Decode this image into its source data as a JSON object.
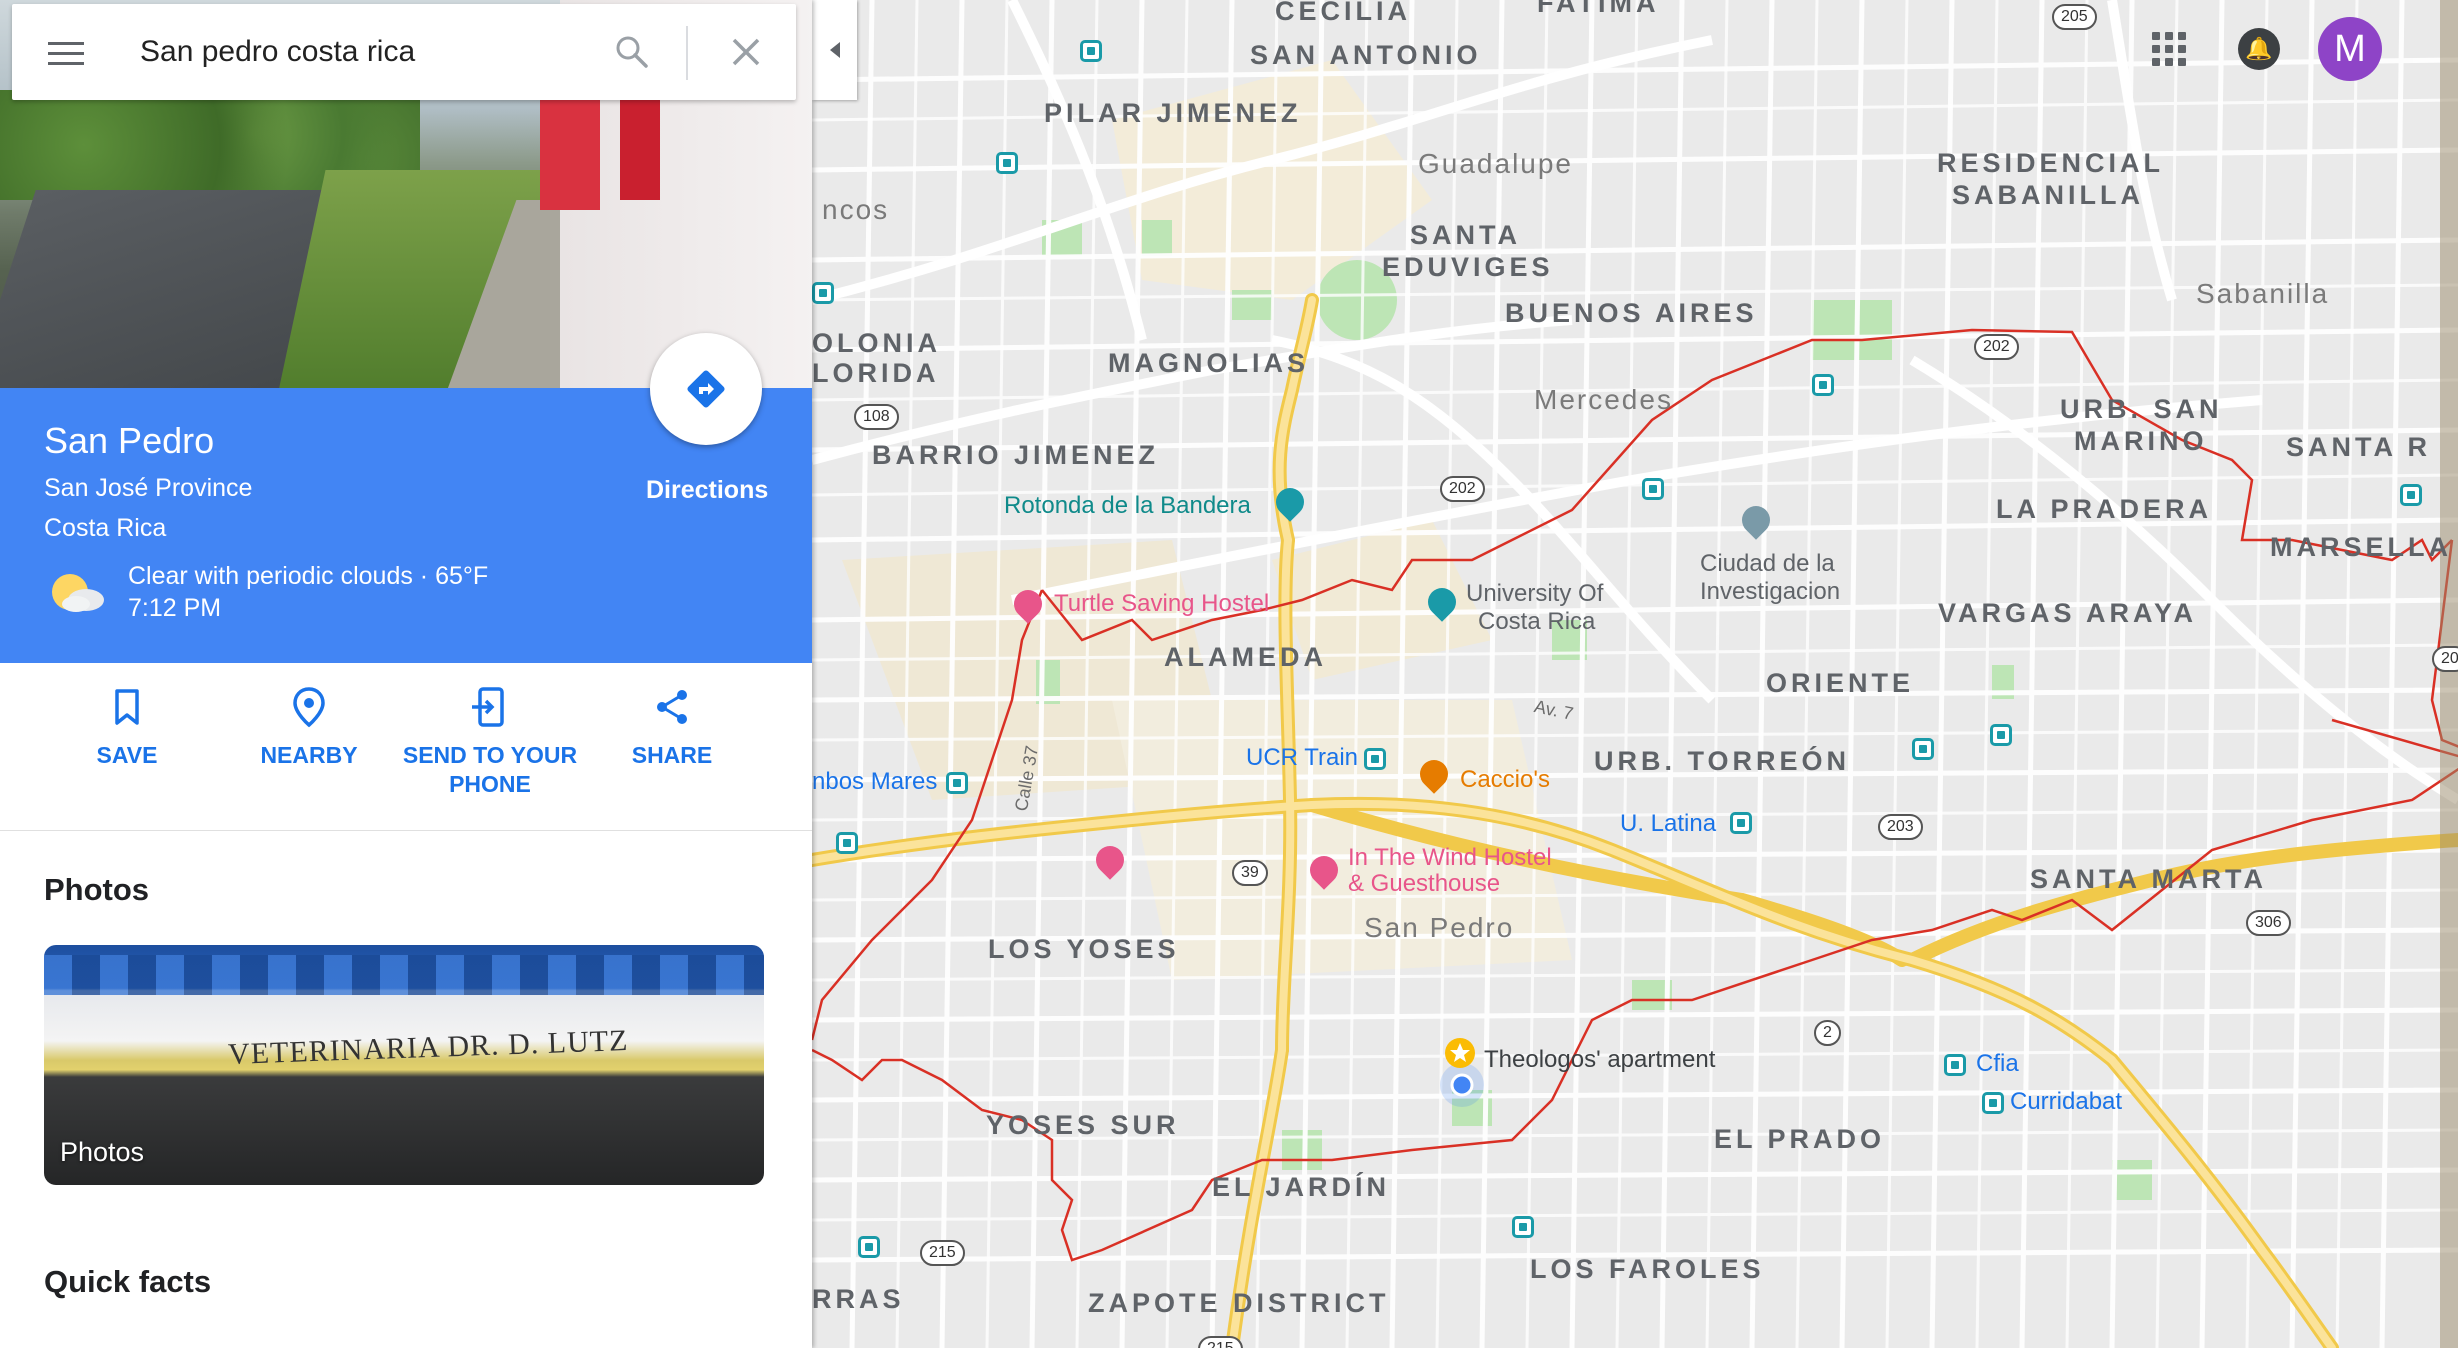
{
  "search": {
    "query": "San pedro costa rica"
  },
  "place": {
    "title": "San Pedro",
    "region": "San José Province",
    "country": "Costa Rica",
    "weather": "Clear with periodic clouds · 65°F",
    "time": "7:12 PM",
    "directions_label": "Directions"
  },
  "actions": {
    "save": "SAVE",
    "nearby": "NEARBY",
    "send_line1": "SEND TO YOUR",
    "send_line2": "PHONE",
    "share": "SHARE"
  },
  "photos": {
    "section_title": "Photos",
    "card_caption": "Photos",
    "sign_text": "VETERINARIA DR. D. LUTZ"
  },
  "quick_facts": {
    "section_title": "Quick facts"
  },
  "account": {
    "avatar_letter": "M"
  },
  "map": {
    "districts": {
      "cecilia": "CECILIA",
      "fatima": "FATIMA",
      "san_antonio": "SAN ANTONIO",
      "pilar_jimenez": "PILAR JIMENEZ",
      "residencial_sabanilla_1": "RESIDENCIAL",
      "residencial_sabanilla_2": "SABANILLA",
      "santa_eduviges_1": "SANTA",
      "santa_eduviges_2": "EDUVIGES",
      "buenos_aires": "BUENOS AIRES",
      "colonia_1": "OLONIA",
      "colonia_2": "LORIDA",
      "magnolias": "MAGNOLIAS",
      "barrio_jimenez": "BARRIO JIMENEZ",
      "urb_san_marino_1": "URB. SAN",
      "urb_san_marino_2": "MARINO",
      "santa_r": "SANTA R",
      "la_pradera": "LA PRADERA",
      "marsella": "MARSELLA",
      "vargas_araya": "VARGAS ARAYA",
      "alameda": "ALAMEDA",
      "oriente": "ORIENTE",
      "urb_torreon": "URB. TORREÓN",
      "santa_marta": "SANTA MARTA",
      "los_yoses": "LOS YOSES",
      "yoses_sur": "YOSES SUR",
      "el_prado": "EL PRADO",
      "el_jardin": "EL JARDÍN",
      "los_faroles": "LOS FAROLES",
      "zapote_district": "ZAPOTE DISTRICT",
      "rras": "RRAS"
    },
    "towns": {
      "guadalupe": "Guadalupe",
      "mercedes": "Mercedes",
      "sabanilla": "Sabanilla",
      "san_pedro": "San Pedro",
      "ncos": "ncos"
    },
    "pois": {
      "rotonda": "Rotonda de la Bandera",
      "turtle_hostel": "Turtle Saving Hostel",
      "ucr_1": "University Of",
      "ucr_2": "Costa Rica",
      "ciudad_1": "Ciudad de la",
      "ciudad_2": "Investigacion",
      "ucr_train": "UCR Train",
      "caccios": "Caccio's",
      "u_latina": "U. Latina",
      "wind_hostel_1": "In The Wind Hostel",
      "wind_hostel_2": "& Guesthouse",
      "theologos": "Theologos' apartment",
      "cfia": "Cfia",
      "curridabat": "Curridabat",
      "bos_mares": "nbos Mares"
    },
    "streets": {
      "av7": "Av. 7",
      "calle37": "Calle 37"
    },
    "route_shields": {
      "r205": "205",
      "r202a": "202",
      "r202b": "202",
      "r108": "108",
      "r39": "39",
      "r203": "203",
      "r306": "306",
      "r2": "2",
      "r215": "215",
      "r215b": "215",
      "r20": "20"
    }
  },
  "colors": {
    "accent_blue": "#4285f4",
    "action_blue": "#1a73e8",
    "boundary_red": "#d93025",
    "avatar_purple": "#8e44c7",
    "road_yellow": "#f6d66b"
  }
}
